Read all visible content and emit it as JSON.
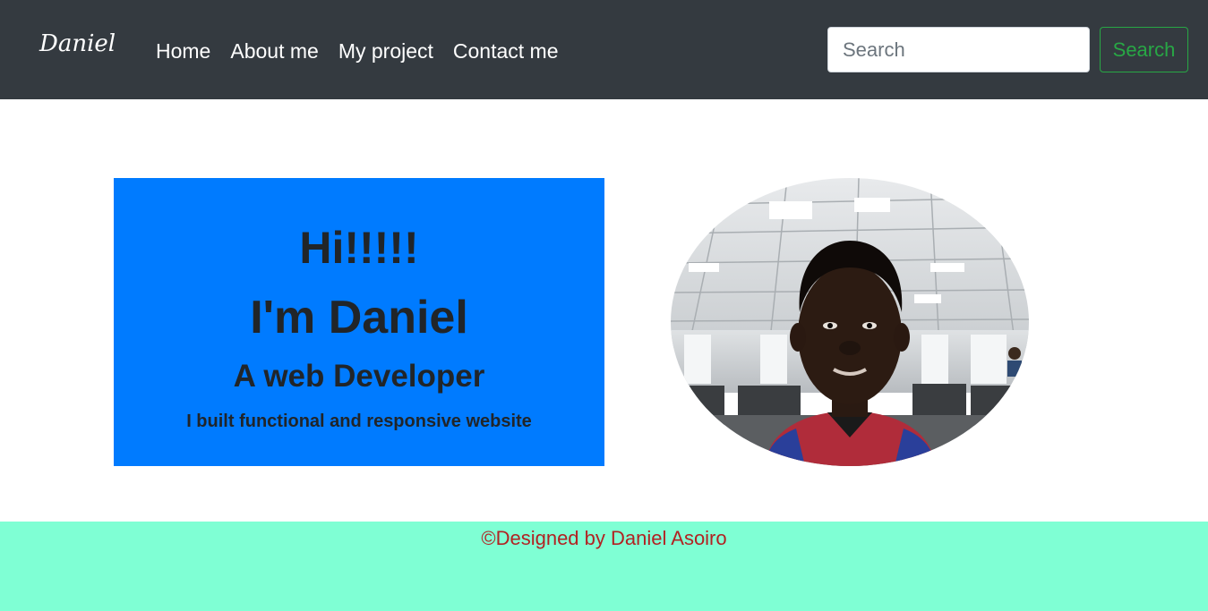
{
  "navbar": {
    "brand": "Daniel",
    "links": [
      "Home",
      "About me",
      "My project",
      "Contact me"
    ],
    "search_placeholder": "Search",
    "search_button": "Search"
  },
  "hero": {
    "greeting": "Hi!!!!!",
    "name": "I'm Daniel",
    "role": "A web Developer",
    "tagline": "I built functional and responsive website"
  },
  "footer": {
    "text": "©Designed by Daniel Asoiro"
  },
  "colors": {
    "navbar_bg": "#343a40",
    "hero_bg": "#007bff",
    "search_button": "#28a745",
    "footer_bg": "#7fffd4",
    "footer_text": "#b22222"
  }
}
